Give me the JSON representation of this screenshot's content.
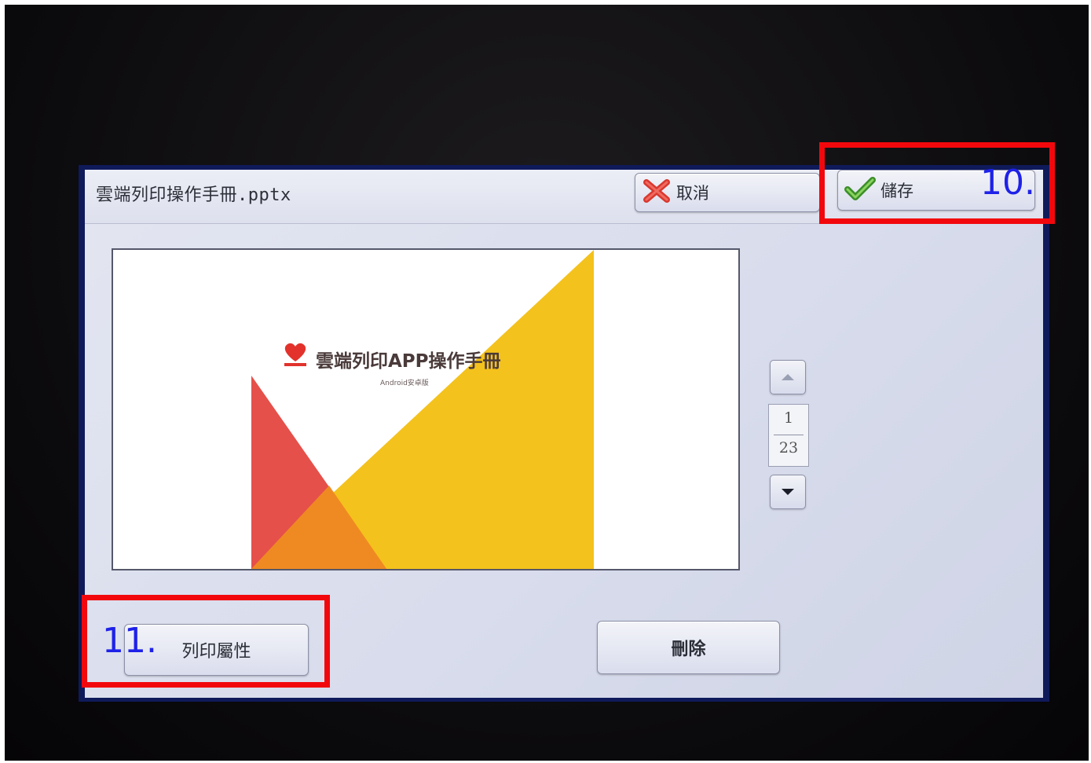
{
  "window": {
    "document_title": "雲端列印操作手冊.pptx"
  },
  "toolbar": {
    "cancel_label": "取消",
    "save_label": "儲存"
  },
  "preview": {
    "slide_title": "雲端列印APP操作手冊",
    "slide_subtitle": "Android安卓版"
  },
  "pager": {
    "current_page": "1",
    "total_pages": "23"
  },
  "actions": {
    "print_properties_label": "列印屬性",
    "delete_label": "刪除"
  },
  "annotations": {
    "step_10": "10.",
    "step_11": "11."
  },
  "colors": {
    "callout_border": "#f2080c",
    "step_label": "#1f22e8",
    "slide_yellow": "#f4c21c",
    "slide_red": "#e5504a",
    "slide_orange": "#ef8a22"
  },
  "icons": {
    "cancel": "red-x-icon",
    "save": "green-checkmark-icon",
    "page_up": "triangle-up-icon",
    "page_down": "triangle-down-icon"
  }
}
